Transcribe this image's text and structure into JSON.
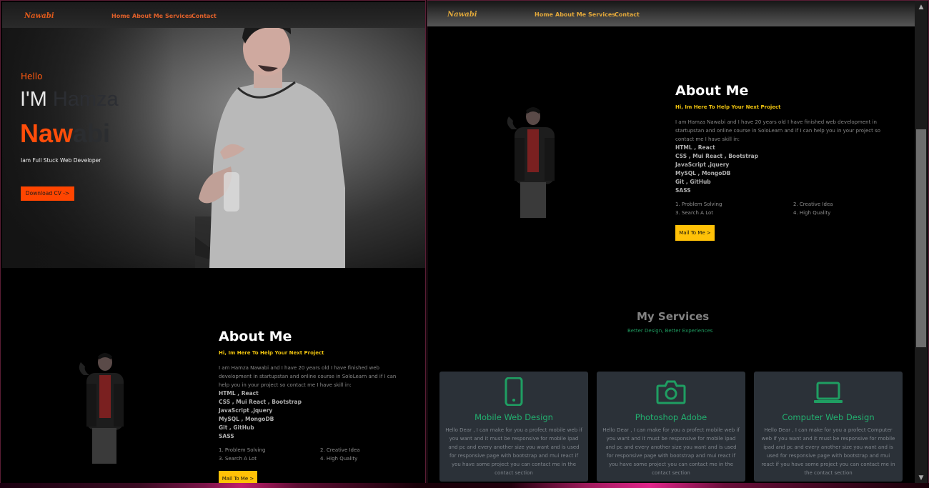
{
  "brand": "Nawabi",
  "nav": [
    "Home",
    "About Me",
    "Services",
    "Contact"
  ],
  "hero": {
    "hello": "Hello",
    "im_prefix": "I'M ",
    "im_name": "Hamza",
    "name_a": "Naw",
    "name_b": "abi",
    "subtitle": "Iam Full Stuck Web Developer",
    "cv_button": "Download CV ->"
  },
  "about": {
    "title": "About Me",
    "subtitle": "Hi, Im Here To Help Your Next Project",
    "body": "I am Hamza Nawabi and I have 20 years old I have finished web development in startupstan and online course in SoloLearn and if I can help you in your project so contact me I have skill in:",
    "skills": [
      "HTML , React",
      "CSS , Mui React , Bootstrap",
      "JavaScript ,jquery",
      "MySQL , MongoDB",
      "Git , GitHub",
      "SASS"
    ],
    "list": [
      "1. Problem Solving",
      "2. Creative Idea",
      "3. Search A Lot",
      "4. High Quality"
    ],
    "left_skills": [
      "HTML , React",
      "CSS , Mui React , Bootstrap",
      "JavaScript ,jquery",
      "MySQL , MongoDB",
      "Git , GitHub",
      "SASS"
    ],
    "mail_button": "Mail To Me >"
  },
  "services": {
    "title": "My Services",
    "subtitle": "Better Design, Better Experiences",
    "cards": [
      {
        "title": "Mobile Web Design",
        "icon": "mobile-phone-icon",
        "text": "Hello Dear , I can make for you a profect mobile web if you want and it must be responsive for mobile ipad and pc and every another size you want and is used for responsive page with bootstrap and mui react if you have some project you can contact me in the contact section"
      },
      {
        "title": "Photoshop Adobe",
        "icon": "camera-icon",
        "text": "Hello Dear , I can make for you a profect mobile web if you want and it must be responsive for mobile ipad and pc and every another size you want and is used for responsive page with bootstrap and mui react if you have some project you can contact me in the contact section"
      },
      {
        "title": "Computer Web Design",
        "icon": "laptop-icon",
        "text": "Hello Dear , I can make for you a profect Computer web if you want and it must be responsive for mobile ipad and pc and every another size you want and is used for responsive page with bootstrap and mui react if you have some project you can contact me in the contact section"
      }
    ]
  },
  "colors": {
    "accent_orange": "#ff4500",
    "accent_yellow": "#ffc107",
    "accent_green": "#22b06f"
  }
}
